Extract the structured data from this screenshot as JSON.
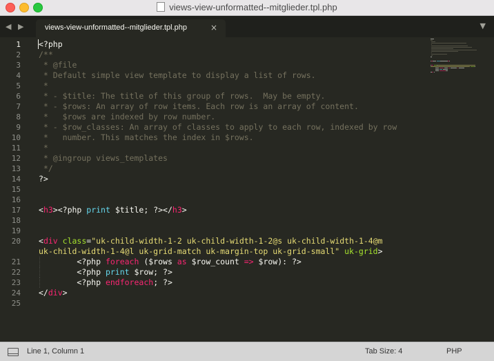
{
  "window": {
    "title": "views-view-unformatted--mitglieder.tpl.php"
  },
  "tabs": [
    {
      "label": "views-view-unformatted--mitglieder.tpl.php",
      "close_icon": "×"
    }
  ],
  "icons": {
    "nav": "◀ ▶",
    "tab_menu": "▼"
  },
  "editor": {
    "active_line": 1,
    "lines": [
      {
        "n": "1",
        "tokens": [
          [
            "w",
            "<?php"
          ]
        ]
      },
      {
        "n": "2",
        "tokens": [
          [
            "c",
            "/**"
          ]
        ]
      },
      {
        "n": "3",
        "tokens": [
          [
            "c",
            " * @file"
          ]
        ]
      },
      {
        "n": "4",
        "tokens": [
          [
            "c",
            " * Default simple view template to display a list of rows."
          ]
        ]
      },
      {
        "n": "5",
        "tokens": [
          [
            "c",
            " *"
          ]
        ]
      },
      {
        "n": "6",
        "tokens": [
          [
            "c",
            " * - $title: The title of this group of rows.  May be empty."
          ]
        ]
      },
      {
        "n": "7",
        "tokens": [
          [
            "c",
            " * - $rows: An array of row items. Each row is an array of content."
          ]
        ]
      },
      {
        "n": "8",
        "tokens": [
          [
            "c",
            " *   $rows are indexed by row number."
          ]
        ]
      },
      {
        "n": "9",
        "tokens": [
          [
            "c",
            " * - $row_classes: An array of classes to apply to each row, indexed by row"
          ]
        ]
      },
      {
        "n": "10",
        "tokens": [
          [
            "c",
            " *   number. This matches the index in $rows."
          ]
        ]
      },
      {
        "n": "11",
        "tokens": [
          [
            "c",
            " *"
          ]
        ]
      },
      {
        "n": "12",
        "tokens": [
          [
            "c",
            " * @ingroup views_templates"
          ]
        ]
      },
      {
        "n": "13",
        "tokens": [
          [
            "c",
            " */"
          ]
        ]
      },
      {
        "n": "14",
        "tokens": [
          [
            "w",
            "?>"
          ]
        ]
      },
      {
        "n": "15",
        "tokens": []
      },
      {
        "n": "16",
        "tokens": []
      },
      {
        "n": "17",
        "tokens": [
          [
            "w",
            "<"
          ],
          [
            "t",
            "h3"
          ],
          [
            "w",
            "><?php "
          ],
          [
            "f",
            "print"
          ],
          [
            "w",
            " $title; ?></"
          ],
          [
            "t",
            "h3"
          ],
          [
            "w",
            ">"
          ]
        ]
      },
      {
        "n": "18",
        "tokens": []
      },
      {
        "n": "19",
        "tokens": []
      },
      {
        "n": "20",
        "tokens": [
          [
            "w",
            "<"
          ],
          [
            "t",
            "div"
          ],
          [
            "w",
            " "
          ],
          [
            "a",
            "class"
          ],
          [
            "w",
            "="
          ],
          [
            "s",
            "\"uk-child-width-1-2 uk-child-width-1-2@s uk-child-width-1-4@m"
          ]
        ]
      },
      {
        "n": "",
        "tokens": [
          [
            "s",
            "uk-child-width-1-4@l uk-grid-match uk-margin-top uk-grid-small\""
          ],
          [
            "w",
            " "
          ],
          [
            "a",
            "uk-grid"
          ],
          [
            "w",
            ">"
          ]
        ]
      },
      {
        "n": "21",
        "tokens": [
          [
            "w",
            "        <?php "
          ],
          [
            "k",
            "foreach"
          ],
          [
            "w",
            " ($rows "
          ],
          [
            "k",
            "as"
          ],
          [
            "w",
            " $row_count "
          ],
          [
            "k",
            "=>"
          ],
          [
            "w",
            " $row): ?>"
          ]
        ]
      },
      {
        "n": "22",
        "tokens": [
          [
            "w",
            "        <?php "
          ],
          [
            "f",
            "print"
          ],
          [
            "w",
            " $row; ?>"
          ]
        ]
      },
      {
        "n": "23",
        "tokens": [
          [
            "w",
            "        <?php "
          ],
          [
            "k",
            "endforeach"
          ],
          [
            "w",
            "; ?>"
          ]
        ]
      },
      {
        "n": "24",
        "tokens": [
          [
            "w",
            "</"
          ],
          [
            "t",
            "div"
          ],
          [
            "w",
            ">"
          ]
        ]
      },
      {
        "n": "25",
        "tokens": []
      }
    ]
  },
  "status": {
    "position": "Line 1, Column 1",
    "tab_size": "Tab Size: 4",
    "syntax": "PHP"
  },
  "colors": {
    "background": "#272822",
    "comment": "#75715e",
    "tag": "#f92672",
    "attr": "#a6e22e",
    "string": "#e6db74",
    "function": "#66d9ef",
    "text": "#f8f8f2"
  }
}
